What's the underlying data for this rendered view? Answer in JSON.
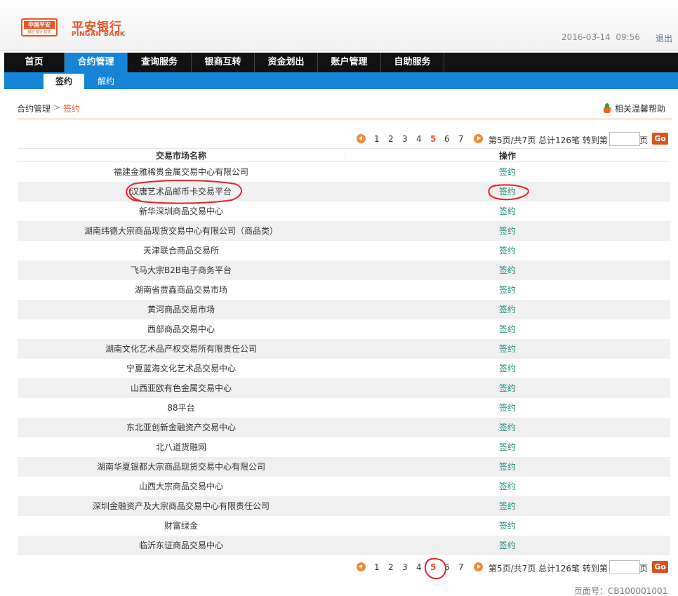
{
  "header": {
    "logo_text": "中国平安",
    "logo_sub": "保险·银行·投资",
    "brand_cn": "平安银行",
    "brand_en": "PINGAN BANK",
    "date": "2016-03-14",
    "time": "09:56",
    "logout_label": "退出"
  },
  "nav": {
    "items": [
      {
        "label": "首页"
      },
      {
        "label": "合约管理",
        "active": true
      },
      {
        "label": "查询服务"
      },
      {
        "label": "银商互转"
      },
      {
        "label": "资金划出"
      },
      {
        "label": "账户管理"
      },
      {
        "label": "自助服务"
      }
    ],
    "sub_items": [
      {
        "label": "签约",
        "active": true
      },
      {
        "label": "解约"
      }
    ]
  },
  "breadcrumb": {
    "parent": "合约管理",
    "separator": ">",
    "current": "签约",
    "help_label": "相关温馨帮助"
  },
  "pager": {
    "pages": [
      "1",
      "2",
      "3",
      "4",
      "5",
      "6",
      "7"
    ],
    "current": "5",
    "info": "第5页/共7页 总计126笔 转到第",
    "page_suffix": "页",
    "go_label": "Go",
    "goto_value": ""
  },
  "table": {
    "headers": {
      "name": "交易市场名称",
      "op": "操作"
    },
    "rows": [
      {
        "name": "福建金雅稀贵金属交易中心有限公司",
        "op": "签约"
      },
      {
        "name": "汉唐艺术品邮币卡交易平台",
        "op": "签约"
      },
      {
        "name": "新华深圳商品交易中心",
        "op": "签约"
      },
      {
        "name": "湖南纬德大宗商品现货交易中心有限公司（商品类）",
        "op": "签约"
      },
      {
        "name": "天津联合商品交易所",
        "op": "签约"
      },
      {
        "name": "飞马大宗B2B电子商务平台",
        "op": "签约"
      },
      {
        "name": "湖南省贾鑫商品交易市场",
        "op": "签约"
      },
      {
        "name": "黄河商品交易市场",
        "op": "签约"
      },
      {
        "name": "西部商品交易中心",
        "op": "签约"
      },
      {
        "name": "湖南文化艺术品产权交易所有限责任公司",
        "op": "签约"
      },
      {
        "name": "宁夏蓝海文化艺术品交易中心",
        "op": "签约"
      },
      {
        "name": "山西亚欧有色金属交易中心",
        "op": "签约"
      },
      {
        "name": "88平台",
        "op": "签约"
      },
      {
        "name": "东北亚创新金融资产交易中心",
        "op": "签约"
      },
      {
        "name": "北八道货融网",
        "op": "签约"
      },
      {
        "name": "湖南华夏银都大宗商品现货交易中心有限公司",
        "op": "签约"
      },
      {
        "name": "山西大宗商品交易中心",
        "op": "签约"
      },
      {
        "name": "深圳金融资产及大宗商品交易中心有限责任公司",
        "op": "签约"
      },
      {
        "name": "财富绿金",
        "op": "签约"
      },
      {
        "name": "临沂东证商品交易中心",
        "op": "签约"
      }
    ]
  },
  "footer": {
    "page_code": "页面号：CB100001001"
  },
  "colors": {
    "brand": "#e8542a",
    "nav_bg": "#111111",
    "nav_active": "#1685d8",
    "link_green": "#1a8a7a",
    "annotation": "#e8202a"
  }
}
